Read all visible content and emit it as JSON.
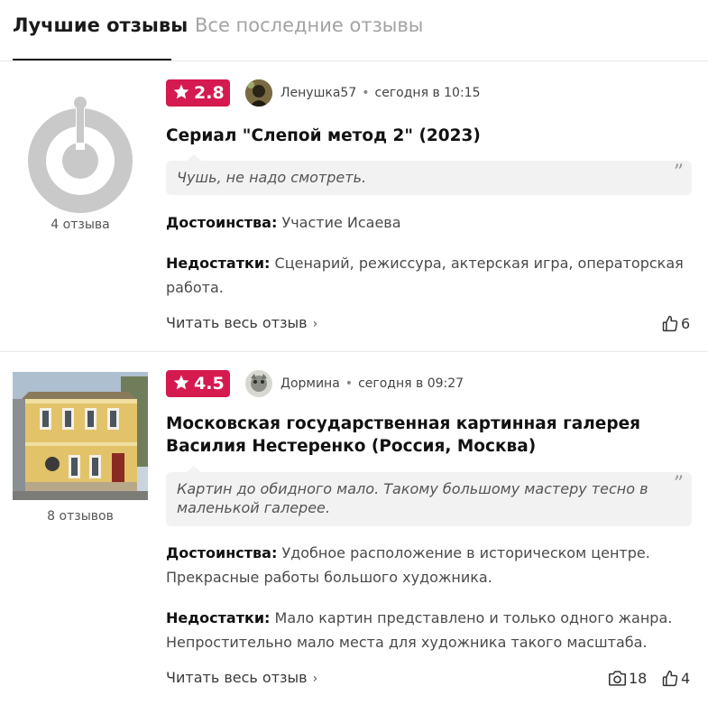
{
  "tabs": {
    "best": "Лучшие отзывы",
    "latest": "Все последние отзывы"
  },
  "reviews": [
    {
      "count": "4 отзыва",
      "rating": "2.8",
      "author": "Ленушка57",
      "time": "сегодня в 10:15",
      "title": "Сериал \"Слепой метод 2\" (2023)",
      "quote": "Чушь, не надо смотреть.",
      "pros_label": "Достоинства:",
      "pros": "Участие Исаева",
      "cons_label": "Недостатки:",
      "cons": "Сценарий, режиссура, актерская игра, операторская работа.",
      "read_more": "Читать весь отзыв",
      "likes": "6"
    },
    {
      "count": "8 отзывов",
      "rating": "4.5",
      "author": "Дормина",
      "time": "сегодня в 09:27",
      "title": "Московская государственная картинная галерея Василия Нестеренко (Россия, Москва)",
      "quote": "Картин до обидного мало. Такому большому мастеру тесно в маленькой галерее.",
      "pros_label": "Достоинства:",
      "pros": "Удобное расположение в историческом центре. Прекрасные работы большого художника.",
      "cons_label": "Недостатки:",
      "cons": "Мало картин представлено и только одного жанра. Непростительно мало места для художника такого масштаба.",
      "read_more": "Читать весь отзыв",
      "photos": "18",
      "likes": "4"
    }
  ],
  "colors": {
    "rating_bg": "#d41a4f",
    "quote_bg": "#f2f2f2",
    "separator": "#e8e8e8"
  }
}
